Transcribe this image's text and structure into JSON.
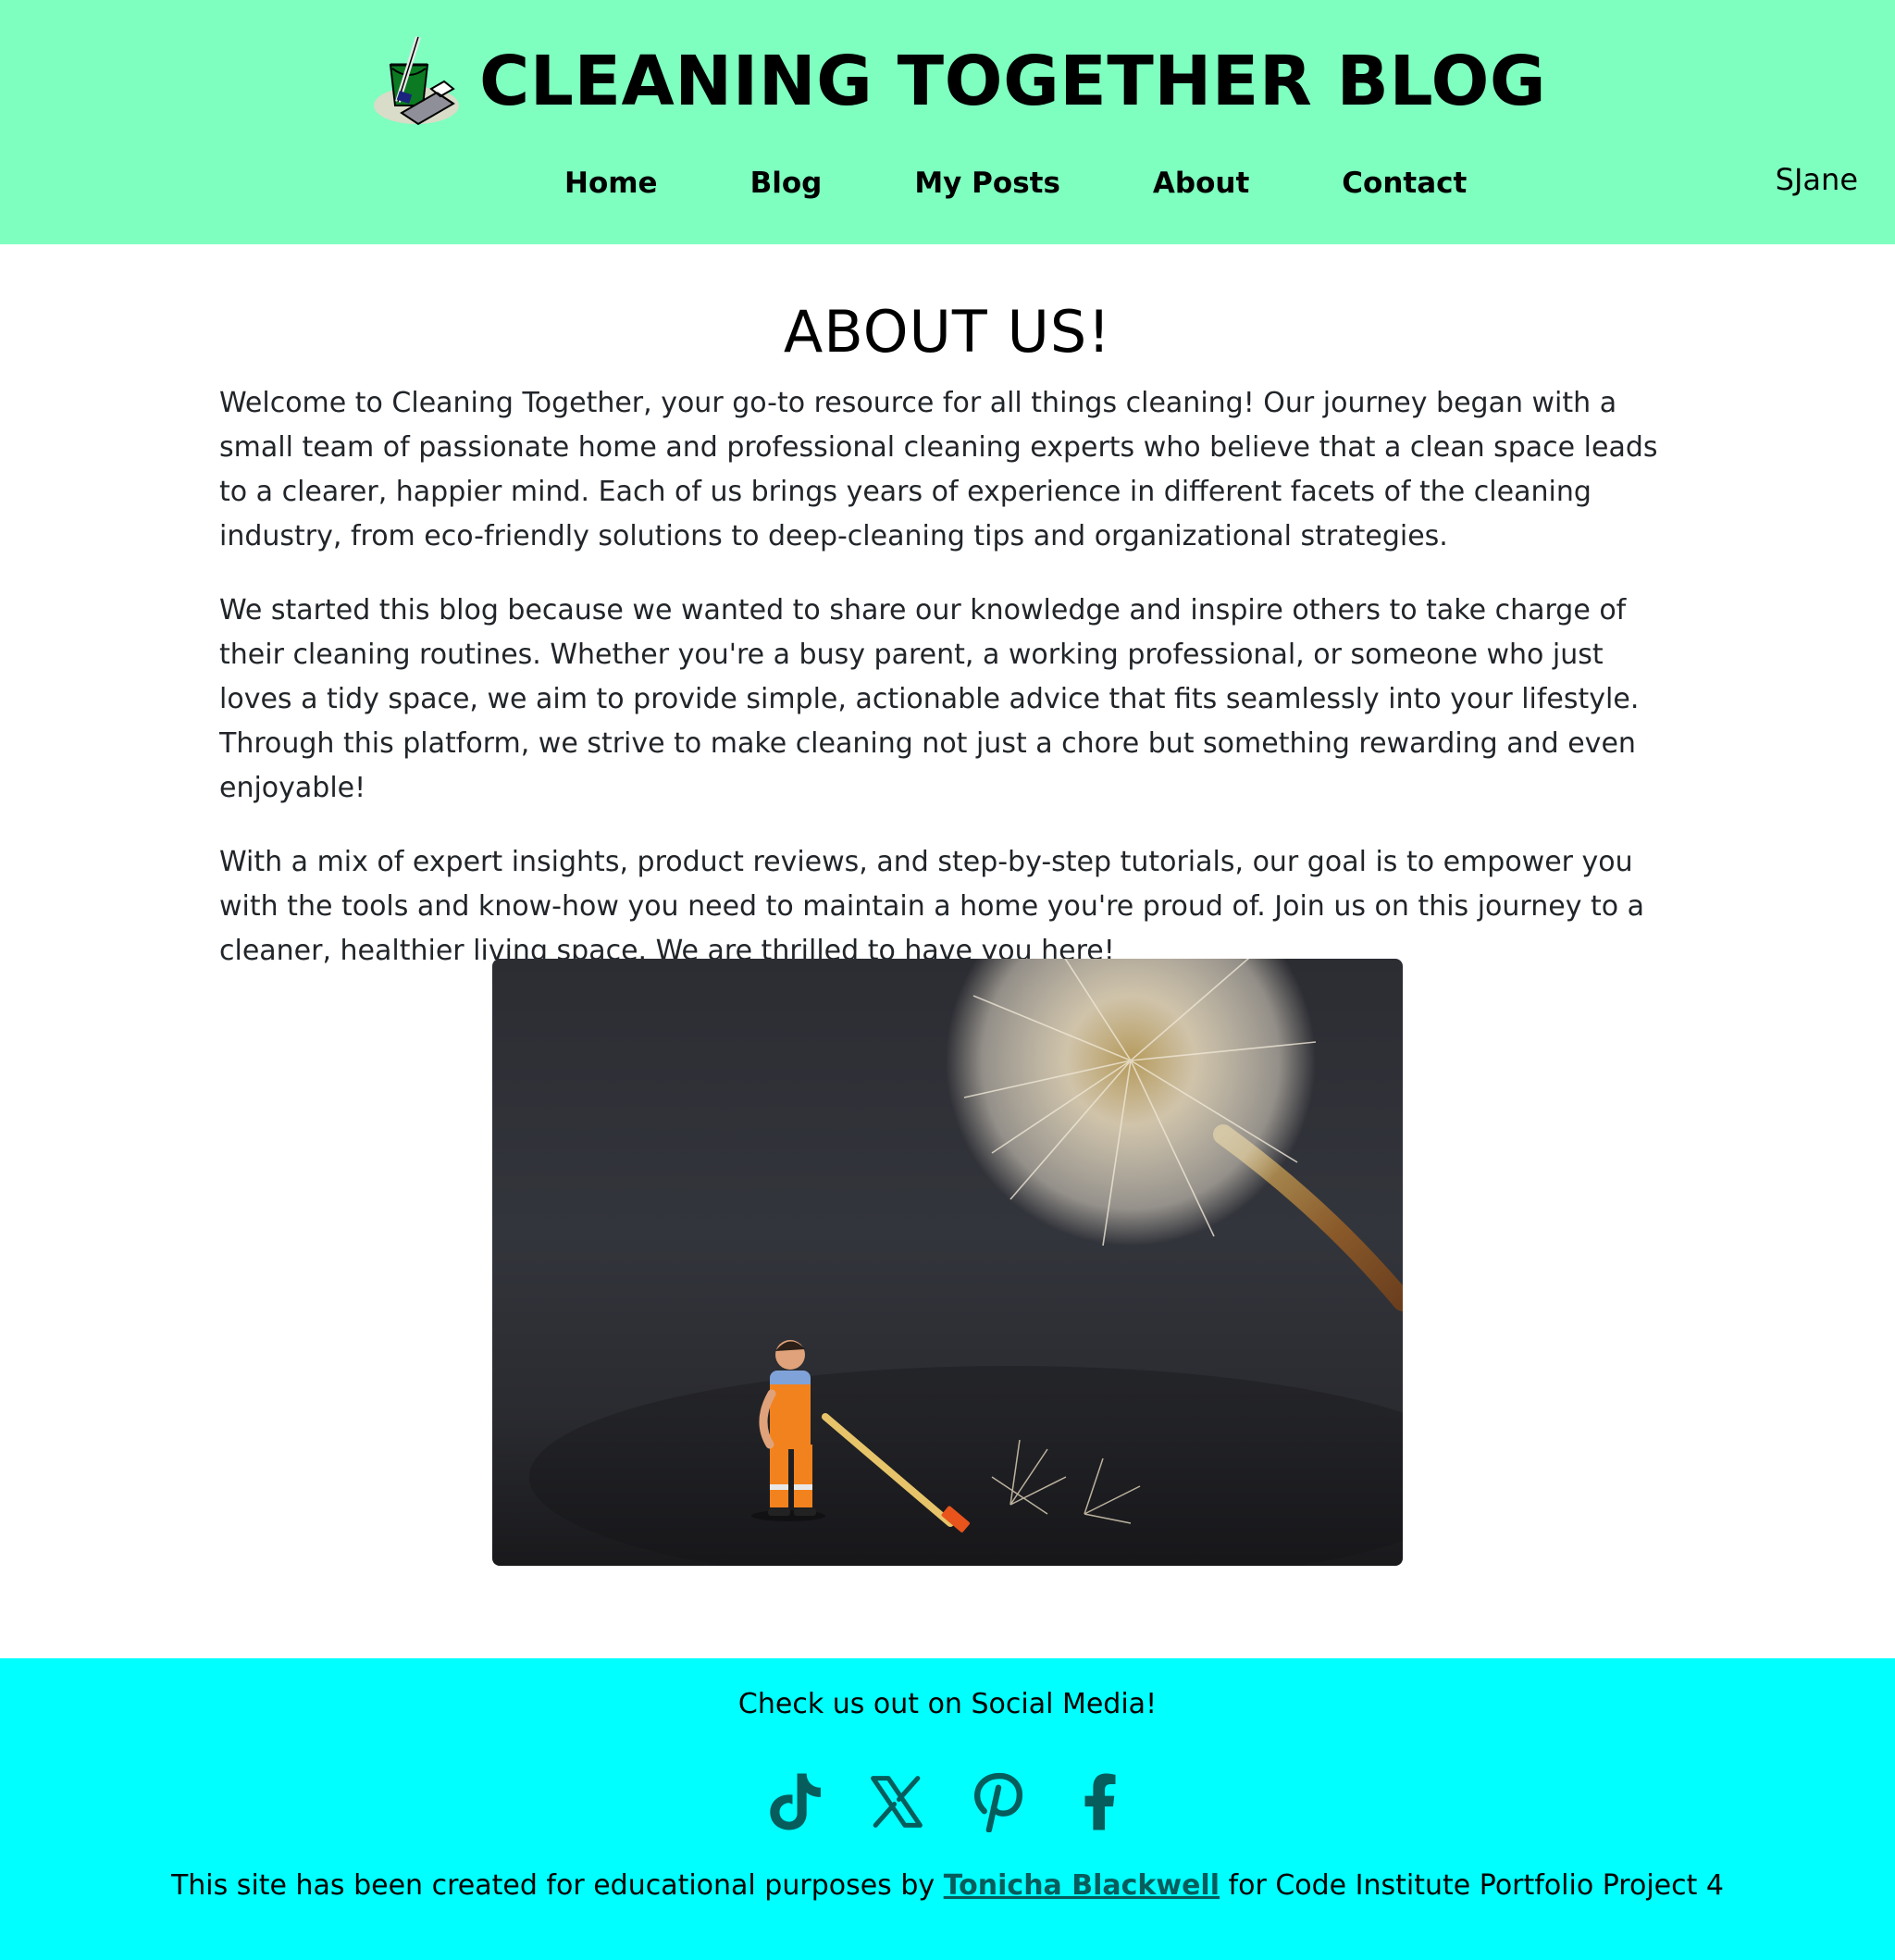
{
  "header": {
    "site_title": "CLEANING TOGETHER BLOG",
    "nav": [
      {
        "label": "Home"
      },
      {
        "label": "Blog"
      },
      {
        "label": "My Posts"
      },
      {
        "label": "About"
      },
      {
        "label": "Contact"
      }
    ],
    "user_name": "SJane",
    "background_color": "#7effbf"
  },
  "main": {
    "heading": "ABOUT US!",
    "paragraphs": [
      "Welcome to Cleaning Together, your go-to resource for all things cleaning! Our journey began with a small team of passionate home and professional cleaning experts who believe that a clean space leads to a clearer, happier mind. Each of us brings years of experience in different facets of the cleaning industry, from eco-friendly solutions to deep-cleaning tips and organizational strategies.",
      "We started this blog because we wanted to share our knowledge and inspire others to take charge of their cleaning routines. Whether you're a busy parent, a working professional, or someone who just loves a tidy space, we aim to provide simple, actionable advice that fits seamlessly into your lifestyle. Through this platform, we strive to make cleaning not just a chore but something rewarding and even enjoyable!",
      "With a mix of expert insights, product reviews, and step-by-step tutorials, our goal is to empower you with the tools and know-how you need to maintain a home you're proud of. Join us on this journey to a cleaner, healthier living space. We are thrilled to have you here!"
    ]
  },
  "footer": {
    "social_heading": "Check us out on Social Media!",
    "social_icons": [
      "tiktok-icon",
      "x-icon",
      "pinterest-icon",
      "facebook-icon"
    ],
    "icon_color": "#075c5c",
    "credits_prefix": "This site has been created for educational purposes by ",
    "credits_author": "Tonicha Blackwell",
    "credits_suffix": " for Code Institute Portfolio Project 4",
    "background_color": "#00ffff"
  }
}
